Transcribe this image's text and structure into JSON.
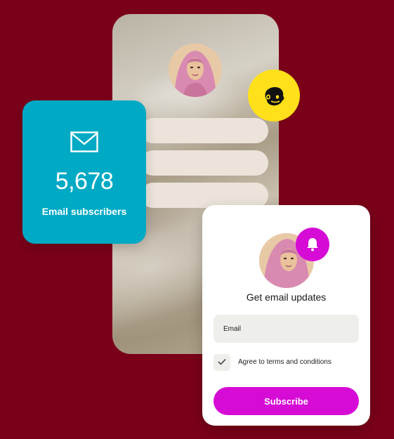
{
  "profile": {
    "avatar": "woman-in-pink-hijab-photo",
    "badge_icon": "mailchimp-icon",
    "link_bars": 3
  },
  "stats": {
    "icon": "envelope-icon",
    "count": "5,678",
    "label": "Email subscribers"
  },
  "signup": {
    "avatar": "woman-in-pink-hijab-photo",
    "badge_icon": "bell-icon",
    "title": "Get email updates",
    "email_placeholder": "Email",
    "terms_label": "Agree to terms and conditions",
    "terms_checked": true,
    "subscribe_label": "Subscribe"
  },
  "colors": {
    "background": "#7a0019",
    "stat_card": "#00a9c4",
    "accent": "#d60bd6",
    "mailchimp": "#ffe01b"
  }
}
